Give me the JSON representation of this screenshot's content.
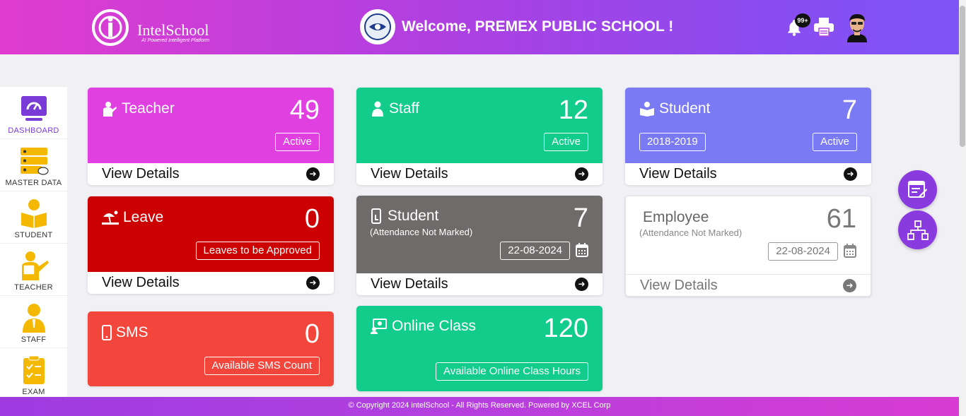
{
  "header": {
    "logo_text": "IntelSchool",
    "logo_tagline": "AI Powered Intelligent Platform",
    "welcome": "Welcome, PREMEX PUBLIC SCHOOL !",
    "notification_count": "99+"
  },
  "sidebar": {
    "items": [
      {
        "label": "DASHBOARD",
        "icon": "dashboard-icon",
        "active": true
      },
      {
        "label": "MASTER DATA",
        "icon": "master-data-icon"
      },
      {
        "label": "STUDENT",
        "icon": "student-icon"
      },
      {
        "label": "TEACHER",
        "icon": "teacher-icon"
      },
      {
        "label": "STAFF",
        "icon": "staff-icon"
      },
      {
        "label": "EXAM",
        "icon": "exam-icon"
      }
    ]
  },
  "cards": {
    "teacher": {
      "title": "Teacher",
      "count": "49",
      "pill": "Active",
      "footer": "View Details",
      "color": "#e040e0"
    },
    "staff": {
      "title": "Staff",
      "count": "12",
      "pill": "Active",
      "footer": "View Details",
      "color": "#12cc8c"
    },
    "student": {
      "title": "Student",
      "count": "7",
      "session": "2018-2019",
      "pill": "Active",
      "footer": "View Details",
      "color": "#7a7af5"
    },
    "leave": {
      "title": "Leave",
      "count": "0",
      "pill": "Leaves to be Approved",
      "footer": "View Details",
      "color": "#cc0000"
    },
    "student_attendance": {
      "title": "Student",
      "subtitle": "(Attendance Not Marked)",
      "count": "7",
      "date": "22-08-2024",
      "footer": "View Details",
      "color": "#706b6b"
    },
    "employee_attendance": {
      "title": "Employee",
      "subtitle": "(Attendance Not Marked)",
      "count": "61",
      "date": "22-08-2024",
      "footer": "View Details",
      "color": "#ffffff"
    },
    "sms": {
      "title": "SMS",
      "count": "0",
      "pill": "Available SMS Count",
      "color": "#f2453c"
    },
    "online_class": {
      "title": "Online Class",
      "count": "120",
      "pill": "Available Online Class Hours",
      "color": "#12cc8c"
    }
  },
  "footer": {
    "copyright": "© Copyright 2024 intelSchool - All Rights Reserved. Powered by XCEL Corp"
  }
}
